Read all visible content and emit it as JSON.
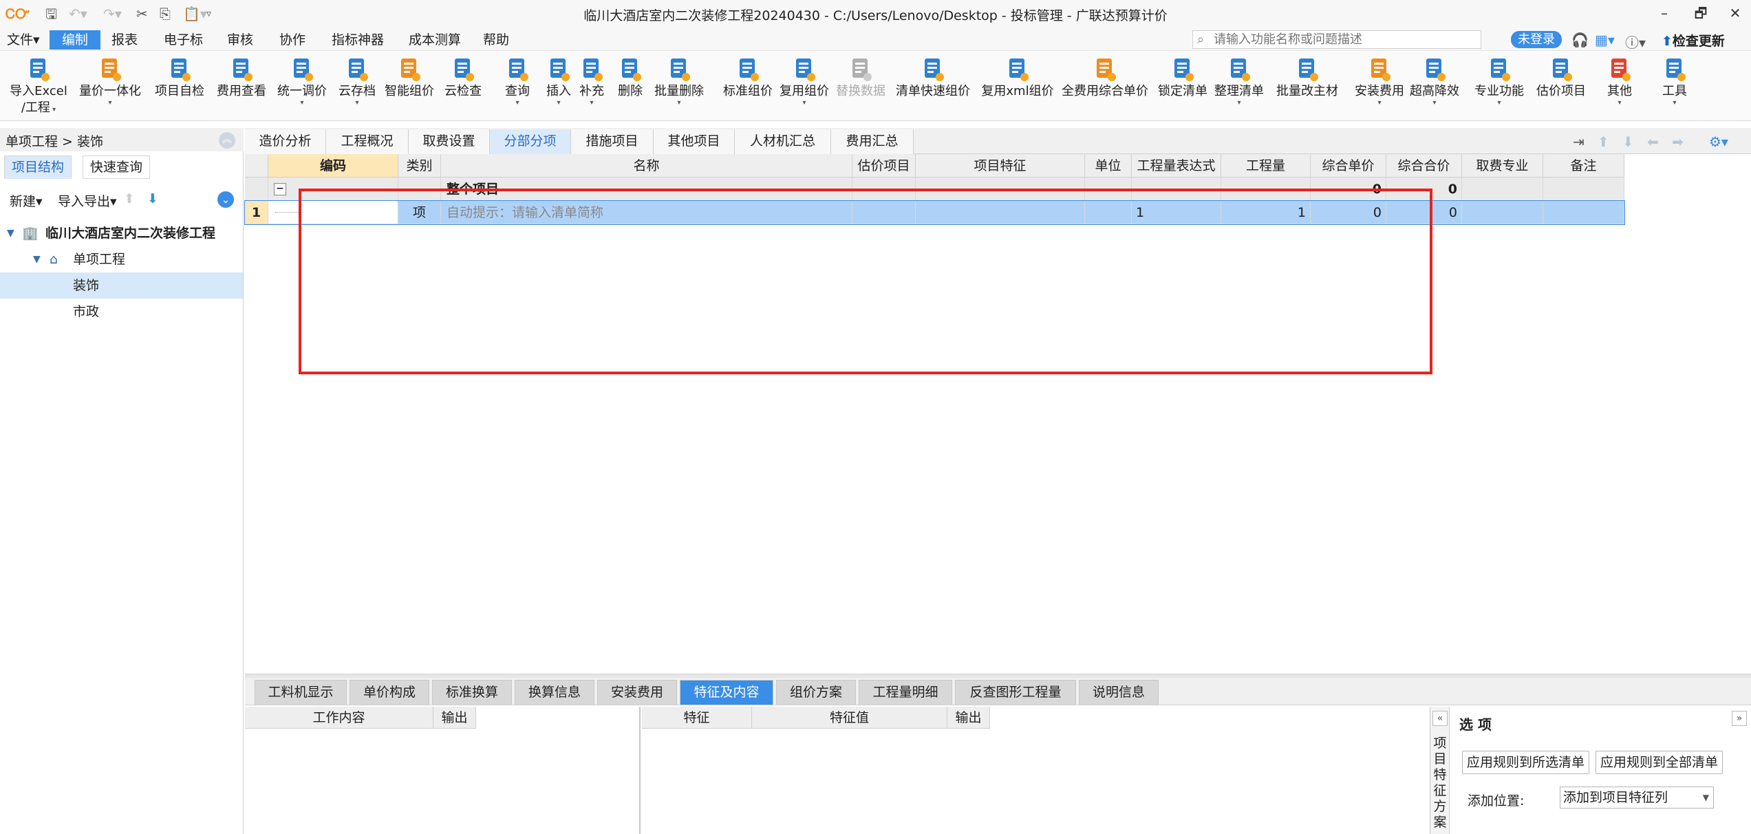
{
  "window": {
    "title": "临川大酒店室内二次装修工程20240430 - C:/Users/Lenovo/Desktop - 投标管理 - 广联达预算计价",
    "controls": [
      "–",
      "🗗",
      "✕"
    ]
  },
  "menu": {
    "items": [
      "文件▾",
      "编制",
      "报表",
      "电子标",
      "审核",
      "协作",
      "指标神器",
      "成本测算",
      "帮助"
    ],
    "active": "编制",
    "search_placeholder": "请输入功能名称或问题描述",
    "login_badge": "未登录",
    "check_update": "检查更新"
  },
  "ribbon": {
    "buttons": [
      {
        "label": "导入Excel",
        "label2": "/工程",
        "icon": "import-excel-icon",
        "caret": true
      },
      {
        "label": "量价一体化",
        "icon": "quantity-price-icon",
        "caret": true
      },
      {
        "label": "项目自检",
        "icon": "self-check-icon"
      },
      {
        "label": "费用查看",
        "icon": "fee-view-icon"
      },
      {
        "label": "统一调价",
        "icon": "adjust-price-icon",
        "caret": true
      },
      {
        "label": "云存档",
        "icon": "cloud-archive-icon",
        "caret": true
      },
      {
        "label": "智能组价",
        "icon": "smart-pricing-icon"
      },
      {
        "label": "云检查",
        "icon": "cloud-check-icon"
      },
      {
        "label": "查询",
        "icon": "query-icon",
        "caret": true
      },
      {
        "label": "插入",
        "icon": "insert-icon",
        "caret": true
      },
      {
        "label": "补充",
        "icon": "supplement-icon",
        "caret": true
      },
      {
        "label": "删除",
        "icon": "delete-icon"
      },
      {
        "label": "批量删除",
        "icon": "batch-delete-icon",
        "caret": true
      },
      {
        "label": "标准组价",
        "icon": "standard-pricing-icon"
      },
      {
        "label": "复用组价",
        "icon": "reuse-pricing-icon",
        "caret": true
      },
      {
        "label": "替换数据",
        "icon": "replace-data-icon",
        "disabled": true
      },
      {
        "label": "清单快速组价",
        "icon": "quick-pricing-icon"
      },
      {
        "label": "复用xml组价",
        "icon": "xml-pricing-icon"
      },
      {
        "label": "全费用综合单价",
        "icon": "full-cost-price-icon"
      },
      {
        "label": "锁定清单",
        "icon": "lock-list-icon"
      },
      {
        "label": "整理清单",
        "icon": "organize-list-icon",
        "caret": true
      },
      {
        "label": "批量改主材",
        "icon": "batch-material-icon"
      },
      {
        "label": "安装费用",
        "icon": "install-fee-icon",
        "caret": true
      },
      {
        "label": "超高降效",
        "icon": "high-efficiency-icon",
        "caret": true
      },
      {
        "label": "专业功能",
        "icon": "professional-icon",
        "caret": true
      },
      {
        "label": "估价项目",
        "icon": "estimate-project-icon"
      },
      {
        "label": "其他",
        "icon": "other-icon",
        "caret": true
      },
      {
        "label": "工具",
        "icon": "tools-icon",
        "caret": true
      }
    ]
  },
  "left_panel": {
    "breadcrumb": "单项工程 > 装饰",
    "tabs": [
      "项目结构",
      "快速查询"
    ],
    "active_tab": "项目结构",
    "tools": {
      "new": "新建▾",
      "import_export": "导入导出▾"
    },
    "tree": [
      {
        "label": "临川大酒店室内二次装修工程",
        "level": 0,
        "bold": true
      },
      {
        "label": "单项工程",
        "level": 1
      },
      {
        "label": "装饰",
        "level": 2,
        "selected": true
      },
      {
        "label": "市政",
        "level": 2
      }
    ]
  },
  "main_tabs": {
    "items": [
      "造价分析",
      "工程概况",
      "取费设置",
      "分部分项",
      "措施项目",
      "其他项目",
      "人材机汇总",
      "费用汇总"
    ],
    "active": "分部分项"
  },
  "grid": {
    "columns": [
      "编码",
      "类别",
      "名称",
      "估价项目",
      "项目特征",
      "单位",
      "工程量表达式",
      "工程量",
      "综合单价",
      "综合合价",
      "取费专业",
      "备注"
    ],
    "total_row": {
      "toggle": "−",
      "name": "整个项目",
      "unit_price": "0",
      "total_price": "0"
    },
    "rows": [
      {
        "no": "1",
        "code": "",
        "type": "项",
        "name": "自动提示：请输入清单简称",
        "expr": "1",
        "qty": "1",
        "unit_price": "0",
        "total_price": "0"
      }
    ]
  },
  "bottom_tabs": {
    "items": [
      "工料机显示",
      "单价构成",
      "标准换算",
      "换算信息",
      "安装费用",
      "特征及内容",
      "组价方案",
      "工程量明细",
      "反查图形工程量",
      "说明信息"
    ],
    "active": "特征及内容"
  },
  "content_table": {
    "headers": [
      "工作内容",
      "输出"
    ]
  },
  "feature_table": {
    "headers": [
      "特征",
      "特征值",
      "输出"
    ]
  },
  "options_panel": {
    "title": "选 项",
    "side_label": "项目特征方案",
    "buttons": [
      "应用规则到所选清单",
      "应用规则到全部清单"
    ],
    "position_label": "添加位置:",
    "position_value": "添加到项目特征列"
  },
  "colors": {
    "accent": "#3a8ee6",
    "selection": "#aed2f7",
    "header_highlight": "#fde7b6",
    "annotation": "#e8231f"
  }
}
